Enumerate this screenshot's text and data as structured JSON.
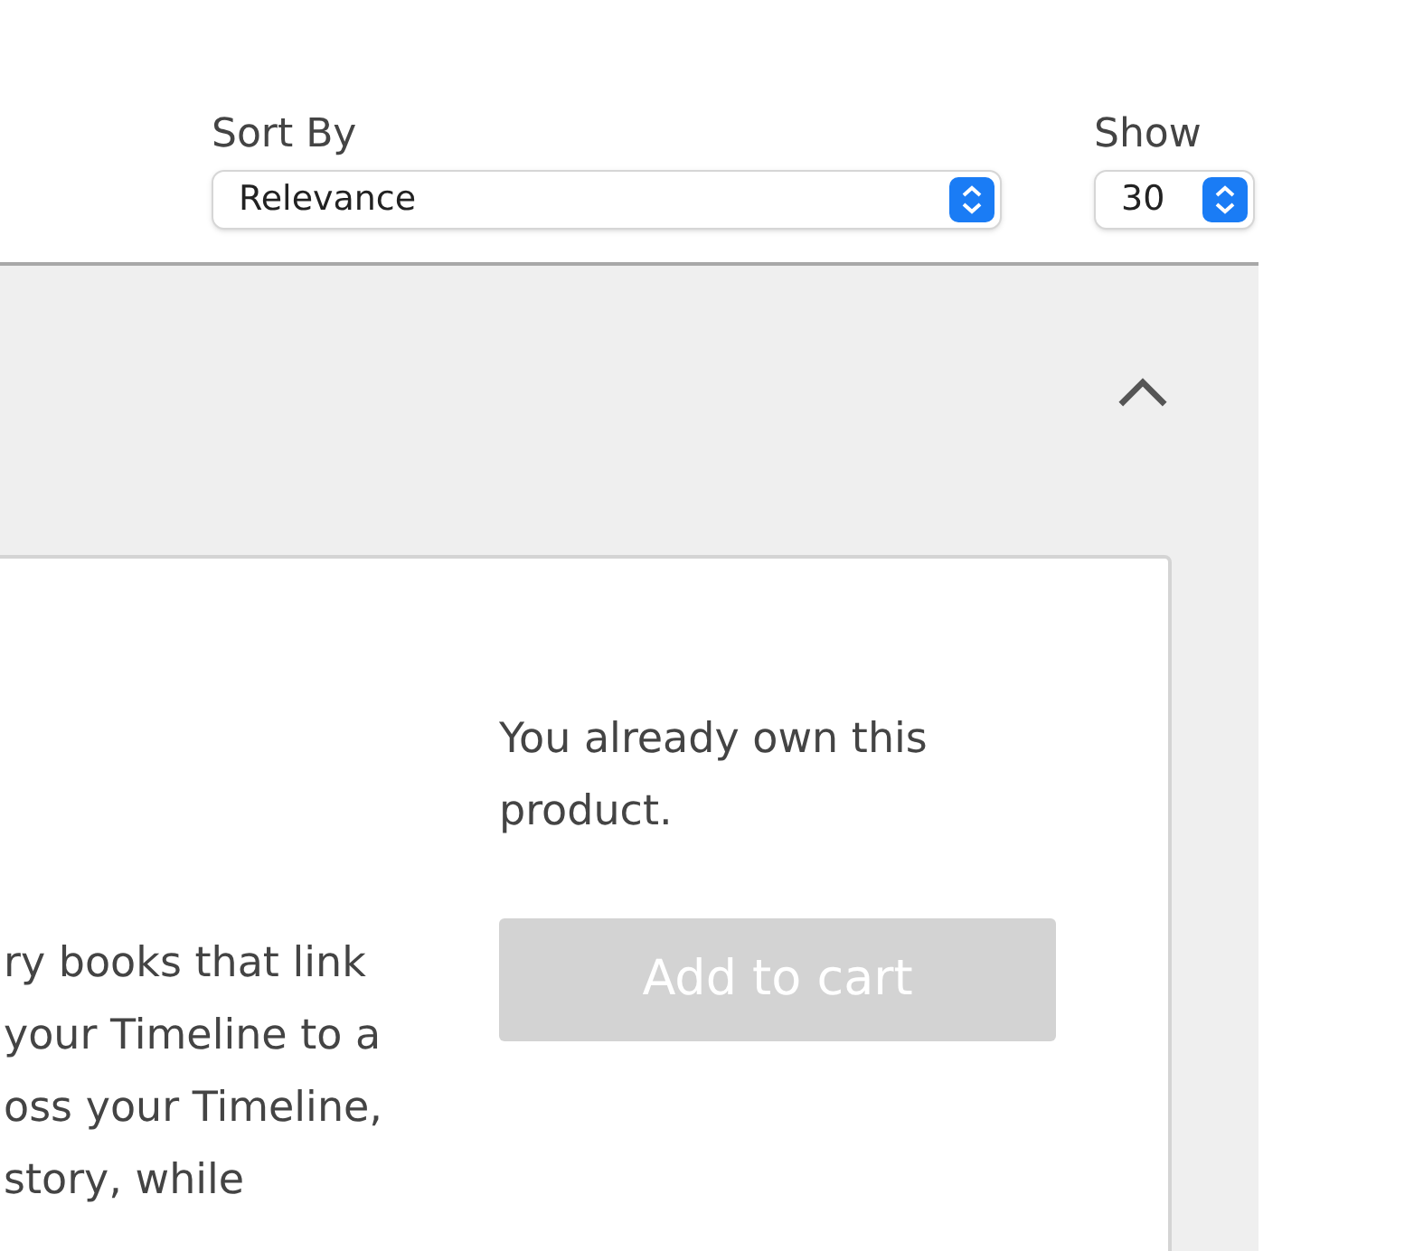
{
  "sort": {
    "label": "Sort By",
    "value": "Relevance"
  },
  "show": {
    "label": "Show",
    "value": "30"
  },
  "section": {
    "expanded": true
  },
  "product": {
    "description_lines": [
      "ry books that link",
      "your Timeline to a",
      "oss your Timeline,",
      "story, while"
    ],
    "ownership_note": "You already own this product.",
    "cart_button": {
      "label": "Add to cart",
      "disabled": true
    }
  }
}
